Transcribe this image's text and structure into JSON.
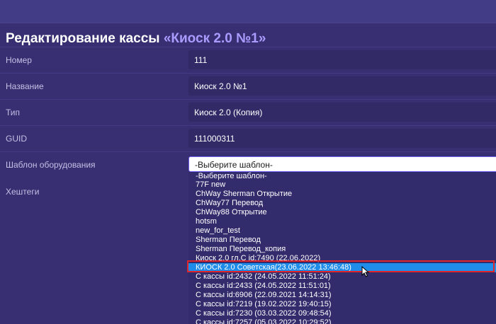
{
  "page": {
    "title_prefix": "Редактирование кассы ",
    "title_name": "«Киоск 2.0 №1»"
  },
  "form": {
    "number_label": "Номер",
    "number_value": "111",
    "name_label": "Название",
    "name_value": "Киоск 2.0 №1",
    "type_label": "Тип",
    "type_value": "Киоск 2.0 (Копия)",
    "guid_label": "GUID",
    "guid_value": "111000311",
    "template_label": "Шаблон оборудования",
    "template_value": "-Выберите шаблон-",
    "hashtags_label": "Хештеги"
  },
  "dropdown": {
    "options": [
      "-Выберите шаблон-",
      "77F new",
      "ChWay Sherman Открытие",
      "ChWay77 Перевод",
      "ChWay88 Открытие",
      "hotsm",
      "new_for_test",
      "Sherman Перевод",
      "Sherman Перевод_копия",
      "Киоск 2.0 гл.С id:7490 (22.06.2022)",
      "КИОСК 2.0 Советская(23.06.2022 13:46:48)",
      "С кассы id:2432 (24.05.2022 11:51:24)",
      "С кассы id:2433 (24.05.2022 11:51:01)",
      "С кассы id:6906 (22.09.2021 14:14:31)",
      "С кассы id:7219 (19.02.2022 19:40:15)",
      "С кассы id:7230 (03.03.2022 09:48:54)",
      "С кассы id:7257 (05.03.2022 10:29:52)"
    ],
    "highlighted_index": 10
  },
  "colors": {
    "background": "#3b3478",
    "accent": "#a99cff",
    "highlight": "#1e8ce8",
    "annotation_frame": "#e0252a"
  }
}
